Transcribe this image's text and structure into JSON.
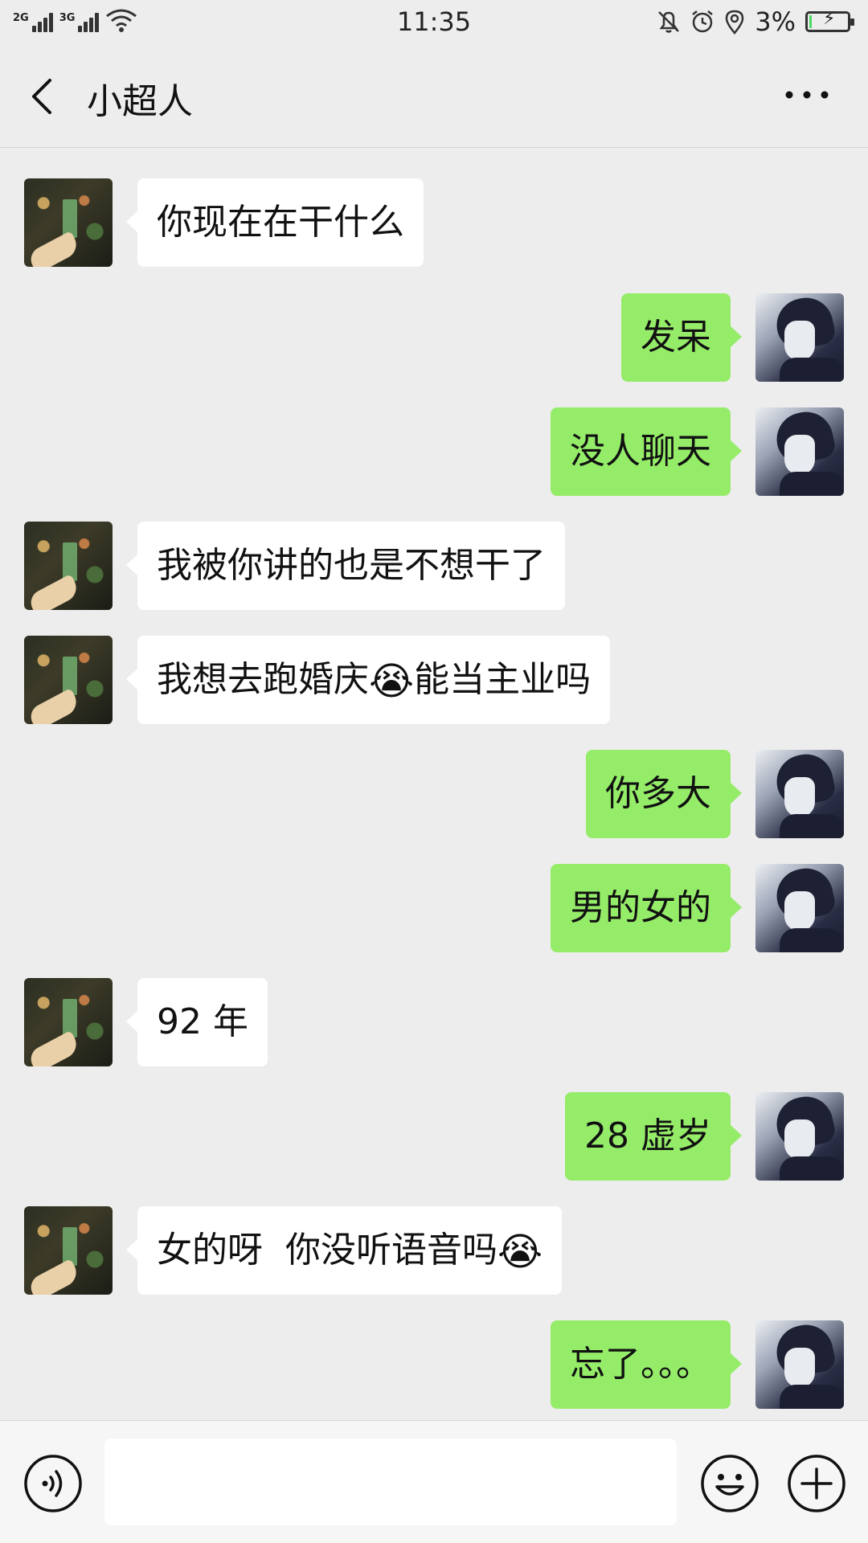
{
  "status_bar": {
    "signal1_label": "2G",
    "signal2_label": "3G",
    "time": "11:35",
    "battery_percent": "3%",
    "battery_level": 0.03
  },
  "header": {
    "title": "小超人"
  },
  "messages": [
    {
      "side": "left",
      "text": "你现在在干什么"
    },
    {
      "side": "right",
      "text": "发呆"
    },
    {
      "side": "right",
      "text": "没人聊天"
    },
    {
      "side": "left",
      "text": "我被你讲的也是不想干了"
    },
    {
      "side": "left",
      "text": "我想去跑婚庆",
      "emoji": "😭",
      "text_after": "能当主业吗"
    },
    {
      "side": "right",
      "text": "你多大"
    },
    {
      "side": "right",
      "text": "男的女的"
    },
    {
      "side": "left",
      "text": "92 年"
    },
    {
      "side": "right",
      "text": "28 虚岁"
    },
    {
      "side": "left",
      "text": "女的呀  你没听语音吗",
      "emoji": "😭"
    },
    {
      "side": "right",
      "text": "忘了。。。"
    }
  ],
  "input": {
    "placeholder": ""
  },
  "icons": {
    "back": "chevron-left-icon",
    "more": "more-dots-icon",
    "voice": "voice-icon",
    "emoji": "emoji-icon",
    "plus": "plus-icon"
  }
}
